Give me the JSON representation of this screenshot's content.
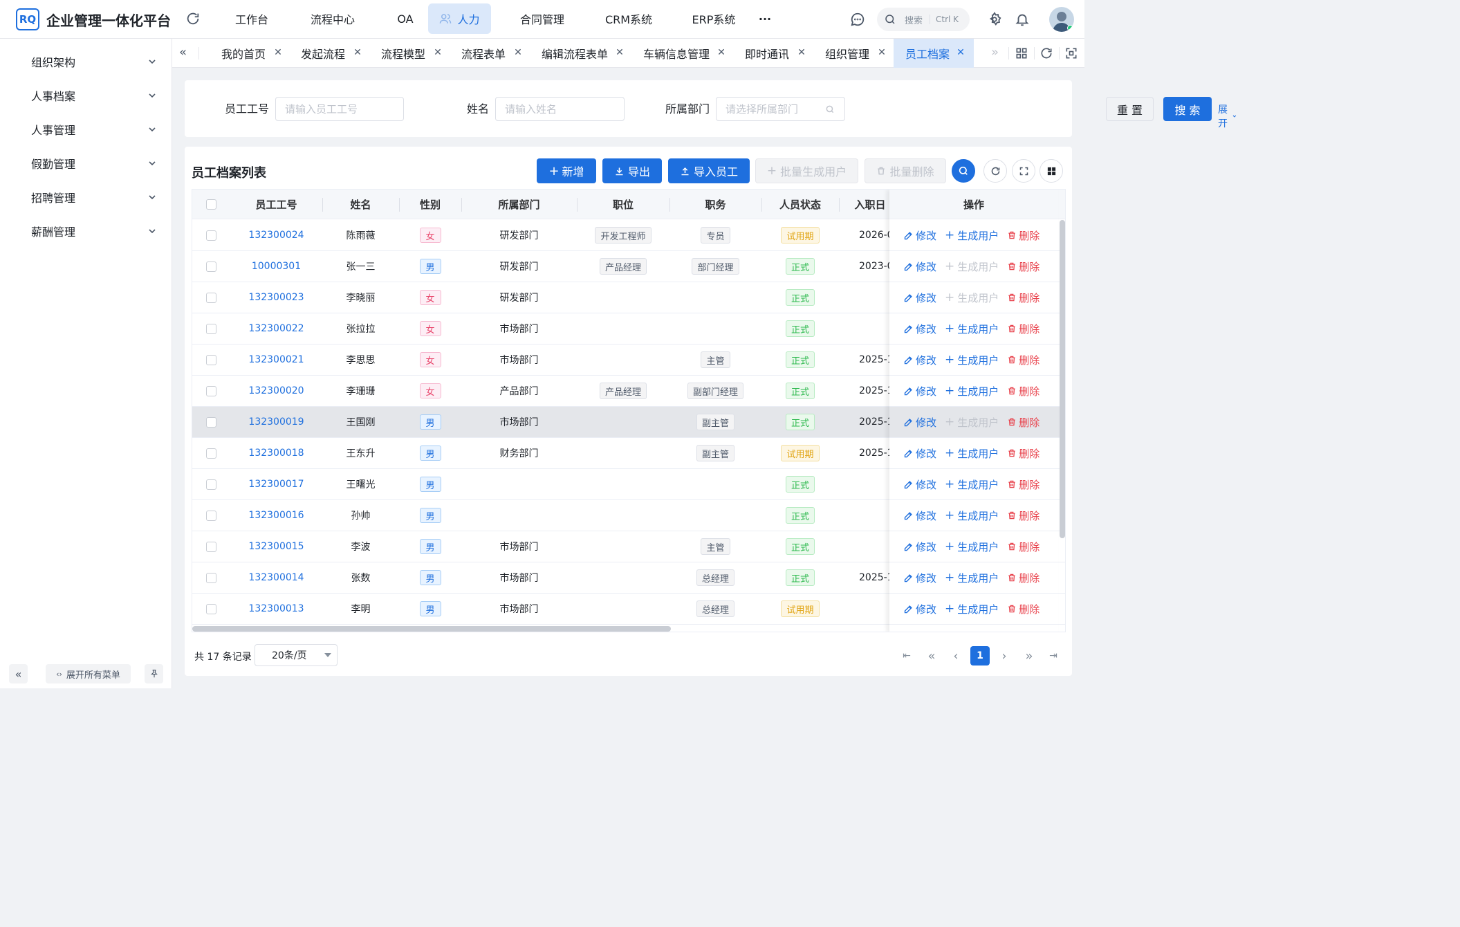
{
  "app": {
    "logo": "RQ",
    "title": "企业管理一体化平台"
  },
  "nav": [
    {
      "label": "工作台"
    },
    {
      "label": "流程中心"
    },
    {
      "label": "OA"
    },
    {
      "label": "人力",
      "icon": "users-icon"
    },
    {
      "label": "合同管理"
    },
    {
      "label": "CRM系统"
    },
    {
      "label": "ERP系统"
    },
    {
      "label": "···"
    }
  ],
  "search": {
    "placeholder": "搜索",
    "shortcut": "Ctrl K"
  },
  "sidebar": {
    "items": [
      {
        "label": "组织架构"
      },
      {
        "label": "人事档案"
      },
      {
        "label": "人事管理"
      },
      {
        "label": "假勤管理"
      },
      {
        "label": "招聘管理"
      },
      {
        "label": "薪酬管理"
      }
    ],
    "expand_all": "展开所有菜单",
    "collapse_glyph": "«"
  },
  "tabs": [
    {
      "label": "我的首页"
    },
    {
      "label": "发起流程"
    },
    {
      "label": "流程模型"
    },
    {
      "label": "流程表单"
    },
    {
      "label": "编辑流程表单"
    },
    {
      "label": "车辆信息管理"
    },
    {
      "label": "即时通讯"
    },
    {
      "label": "组织管理"
    },
    {
      "label": "员工档案",
      "active": true
    }
  ],
  "filters": {
    "emp_no": {
      "label": "员工工号",
      "placeholder": "请输入员工工号"
    },
    "name": {
      "label": "姓名",
      "placeholder": "请输入姓名"
    },
    "dept": {
      "label": "所属部门",
      "placeholder": "请选择所属部门"
    },
    "reset": "重 置",
    "search": "搜 索",
    "expand": "展开"
  },
  "list": {
    "title": "员工档案列表",
    "actions": {
      "add": "新增",
      "export": "导出",
      "import": "导入员工",
      "batch_user": "批量生成用户",
      "batch_delete": "批量删除"
    }
  },
  "table": {
    "columns": [
      "员工工号",
      "姓名",
      "性别",
      "所属部门",
      "职位",
      "职务",
      "人员状态",
      "入职日",
      "操作"
    ],
    "ops": {
      "edit": "修改",
      "gen": "生成用户",
      "del": "删除"
    },
    "rows": [
      {
        "id": "132300024",
        "name": "陈雨薇",
        "gender": "女",
        "dept": "研发部门",
        "position": "开发工程师",
        "duty": "专员",
        "status": "试用期",
        "date": "2026-0",
        "gen_enabled": true
      },
      {
        "id": "10000301",
        "name": "张一三",
        "gender": "男",
        "dept": "研发部门",
        "position": "产品经理",
        "duty": "部门经理",
        "status": "正式",
        "date": "2023-0",
        "gen_enabled": false
      },
      {
        "id": "132300023",
        "name": "李晓丽",
        "gender": "女",
        "dept": "研发部门",
        "position": "",
        "duty": "",
        "status": "正式",
        "date": "",
        "gen_enabled": false
      },
      {
        "id": "132300022",
        "name": "张拉拉",
        "gender": "女",
        "dept": "市场部门",
        "position": "",
        "duty": "",
        "status": "正式",
        "date": "",
        "gen_enabled": true
      },
      {
        "id": "132300021",
        "name": "李思思",
        "gender": "女",
        "dept": "市场部门",
        "position": "",
        "duty": "主管",
        "status": "正式",
        "date": "2025-1",
        "gen_enabled": true
      },
      {
        "id": "132300020",
        "name": "李珊珊",
        "gender": "女",
        "dept": "产品部门",
        "position": "产品经理",
        "duty": "副部门经理",
        "status": "正式",
        "date": "2025-1",
        "gen_enabled": true
      },
      {
        "id": "132300019",
        "name": "王国刚",
        "gender": "男",
        "dept": "市场部门",
        "position": "",
        "duty": "副主管",
        "status": "正式",
        "date": "2025-1",
        "gen_enabled": false,
        "highlight": true
      },
      {
        "id": "132300018",
        "name": "王东升",
        "gender": "男",
        "dept": "财务部门",
        "position": "",
        "duty": "副主管",
        "status": "试用期",
        "date": "2025-1",
        "gen_enabled": true
      },
      {
        "id": "132300017",
        "name": "王曙光",
        "gender": "男",
        "dept": "",
        "position": "",
        "duty": "",
        "status": "正式",
        "date": "",
        "gen_enabled": true
      },
      {
        "id": "132300016",
        "name": "孙帅",
        "gender": "男",
        "dept": "",
        "position": "",
        "duty": "",
        "status": "正式",
        "date": "",
        "gen_enabled": true
      },
      {
        "id": "132300015",
        "name": "李波",
        "gender": "男",
        "dept": "市场部门",
        "position": "",
        "duty": "主管",
        "status": "正式",
        "date": "",
        "gen_enabled": true
      },
      {
        "id": "132300014",
        "name": "张数",
        "gender": "男",
        "dept": "市场部门",
        "position": "",
        "duty": "总经理",
        "status": "正式",
        "date": "2025-1",
        "gen_enabled": true
      },
      {
        "id": "132300013",
        "name": "李明",
        "gender": "男",
        "dept": "市场部门",
        "position": "",
        "duty": "总经理",
        "status": "试用期",
        "date": "",
        "gen_enabled": true
      }
    ]
  },
  "pagination": {
    "total": "共 17 条记录",
    "page_size": "20条/页",
    "current": "1"
  },
  "colors": {
    "primary": "#1e6fde",
    "danger": "#e8414b",
    "success": "#2cb94d",
    "warning": "#e0a310"
  }
}
